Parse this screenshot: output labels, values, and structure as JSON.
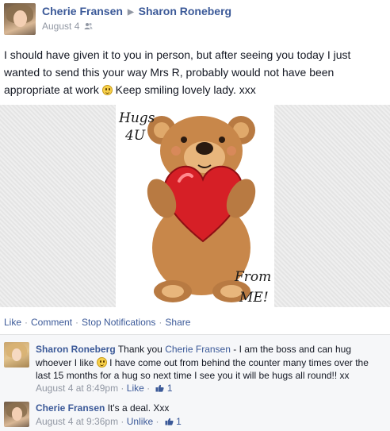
{
  "post": {
    "author": "Cherie Fransen",
    "recipient": "Sharon Roneberg",
    "arrow": "▶",
    "date": "August 4",
    "text_part1": "I should have given it to you in person, but after seeing you today I just wanted to send this your way Mrs R, probably would not have been appropriate at work",
    "text_part2": "Keep smiling lovely lady. xxx",
    "image": {
      "caption_top_line1": "Hugs",
      "caption_top_line2": "4U",
      "caption_bottom_line1": "From",
      "caption_bottom_line2": "ME!"
    }
  },
  "actions": {
    "like": "Like",
    "comment": "Comment",
    "stop_notifications": "Stop Notifications",
    "share": "Share",
    "separator": "·"
  },
  "comments": [
    {
      "author": "Sharon Roneberg",
      "mention": "Cherie Fransen",
      "text_before_mention": "Thank you",
      "text_after_mention": "- I am the boss and can hug whoever I like",
      "text_after_smiley": "I have come out from behind the counter many times over the last 15 months for a hug so next time I see you it will be hugs all round!! xx",
      "time": "August 4 at 8:49pm",
      "action": "Like",
      "likes": "1"
    },
    {
      "author": "Cherie Fransen",
      "text": "It's a deal. Xxx",
      "time": "August 4 at 9:36pm",
      "action": "Unlike",
      "likes": "1"
    }
  ],
  "colors": {
    "link": "#3b5998",
    "meta": "#9197a3",
    "comment_bg": "#f6f7f9",
    "heart": "#d61f26",
    "bear": "#c8874a"
  }
}
